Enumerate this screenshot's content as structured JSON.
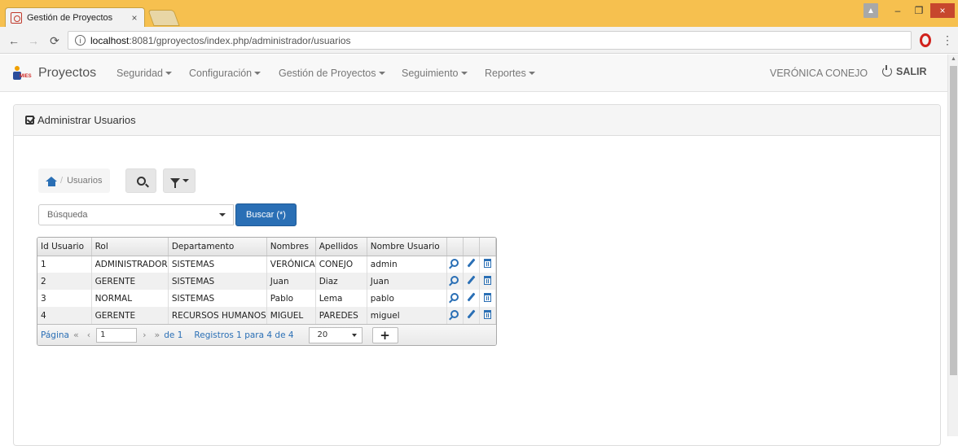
{
  "browser": {
    "tab_title": "Gestión de Proyectos",
    "tab_close": "×",
    "url_host": "localhost",
    "url_rest": ":8081/gproyectos/index.php/administrador/usuarios",
    "win_minimize": "–",
    "win_maximize": "❐",
    "win_close": "×"
  },
  "navbar": {
    "brand": "Proyectos",
    "menus": [
      "Seguridad",
      "Configuración",
      "Gestión de Proyectos",
      "Seguimiento",
      "Reportes"
    ],
    "user": "VERÓNICA CONEJO",
    "logout": "SALIR"
  },
  "panel": {
    "title": "Administrar Usuarios"
  },
  "breadcrumb": {
    "separator": "/",
    "current": "Usuarios"
  },
  "search": {
    "placeholder": "Búsqueda",
    "button": "Buscar (*)"
  },
  "grid": {
    "columns": [
      "Id Usuario",
      "Rol",
      "Departamento",
      "Nombres",
      "Apellidos",
      "Nombre Usuario"
    ],
    "rows": [
      [
        "1",
        "ADMINISTRADOR",
        "SISTEMAS",
        "VERÓNICA",
        "CONEJO",
        "admin"
      ],
      [
        "2",
        "GERENTE",
        "SISTEMAS",
        "Juan",
        "Diaz",
        "Juan"
      ],
      [
        "3",
        "NORMAL",
        "SISTEMAS",
        "Pablo",
        "Lema",
        "pablo"
      ],
      [
        "4",
        "GERENTE",
        "RECURSOS HUMANOS",
        "MIGUEL",
        "PAREDES",
        "miguel"
      ]
    ],
    "pager": {
      "page_label": "Página",
      "first": "«",
      "prev": "‹",
      "page_value": "1",
      "next": "›",
      "last": "»",
      "of_label": "de 1",
      "records": "Registros 1 para 4 de 4",
      "rows_per_page": "20",
      "add": "+"
    }
  },
  "colors": {
    "brand_blue": "#2a6fb5",
    "browser_frame": "#f6c04f",
    "close_red": "#c7472d"
  }
}
